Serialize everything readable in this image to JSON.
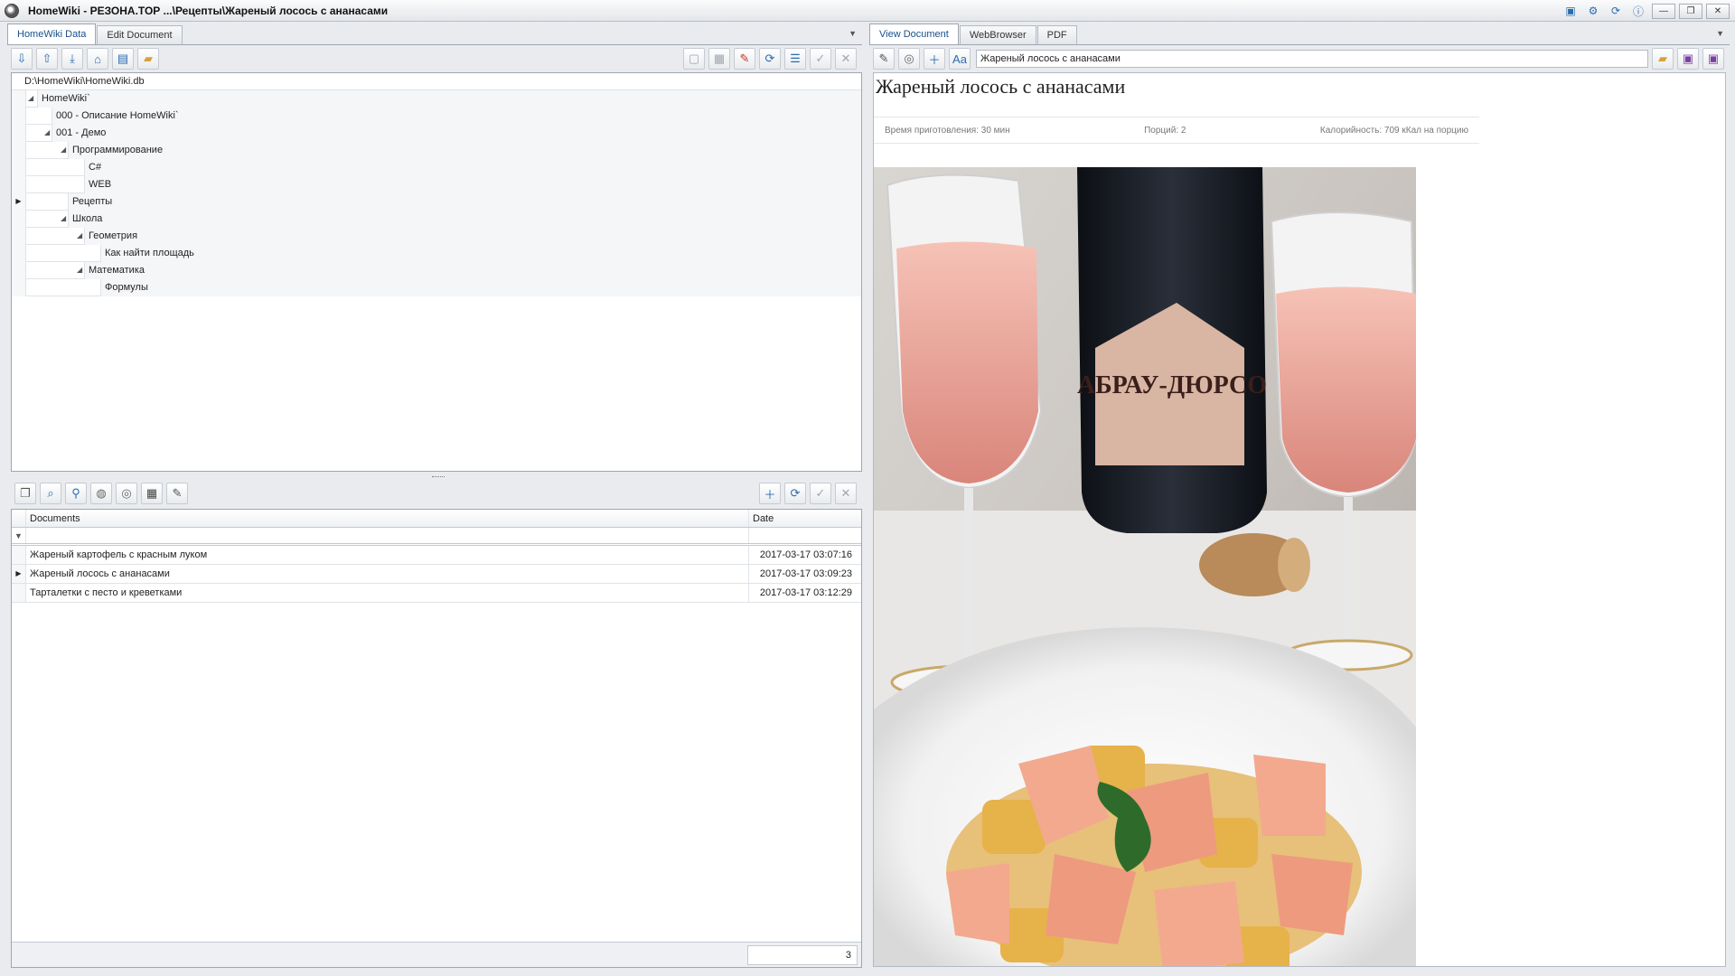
{
  "window": {
    "title": "HomeWiki - РЕЗОНА.ТОР   ...\\Рецепты\\Жареный лосось с ананасами"
  },
  "left_tabs": [
    "HomeWiki Data",
    "Edit Document"
  ],
  "tree": {
    "path": "D:\\HomeWiki\\HomeWiki.db",
    "nodes": [
      {
        "label": "HomeWiki`",
        "expander": "◢"
      },
      {
        "label": "000 - Описание HomeWiki`",
        "expander": ""
      },
      {
        "label": "001 - Демо",
        "expander": "◢"
      },
      {
        "label": "Программирование",
        "expander": "◢"
      },
      {
        "label": "C#",
        "expander": ""
      },
      {
        "label": "WEB",
        "expander": ""
      },
      {
        "label": "Рецепты",
        "expander": "",
        "selected_marker": "▶"
      },
      {
        "label": "Школа",
        "expander": "◢"
      },
      {
        "label": "Геометрия",
        "expander": "◢"
      },
      {
        "label": "Как найти площадь",
        "expander": ""
      },
      {
        "label": "Математика",
        "expander": "◢"
      },
      {
        "label": "Формулы",
        "expander": ""
      }
    ]
  },
  "grid": {
    "columns": {
      "documents": "Documents",
      "date": "Date"
    },
    "filter_icon": "▼",
    "rows": [
      {
        "title": "Жареный картофель с красным луком",
        "date": "2017-03-17 03:07:16",
        "marker": ""
      },
      {
        "title": "Жареный лосось с ананасами",
        "date": "2017-03-17 03:09:23",
        "marker": "▶"
      },
      {
        "title": "Тарталетки с песто и креветками",
        "date": "2017-03-17 03:12:29",
        "marker": ""
      }
    ],
    "count": "3"
  },
  "right_tabs": [
    "View Document",
    "WebBrowser",
    "PDF"
  ],
  "address": "Жареный лосось с ананасами",
  "document": {
    "title": "Жареный лосось с ананасами",
    "cook_time": "Время приготовления: 30 мин",
    "servings": "Порций: 2",
    "calories": "Калорийность: 709 кКал на порцию",
    "label_text": "АБРАУ-ДЮРСО"
  },
  "colors": {
    "accent": "#1a4f8b",
    "wine": "#e9a7a0",
    "salmon": "#f3a98e",
    "pineapple": "#e6b24a"
  }
}
